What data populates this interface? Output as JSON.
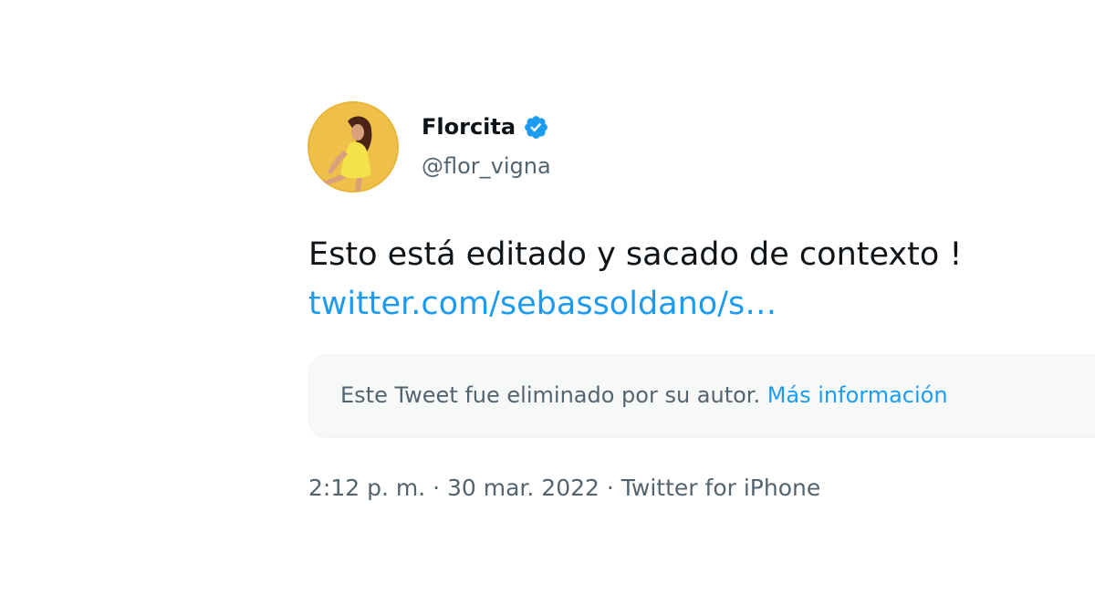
{
  "author": {
    "display_name": "Florcita",
    "handle": "@flor_vigna",
    "verified": true,
    "avatar_icon": "avatar-photo",
    "verified_icon": "verified-badge-icon"
  },
  "tweet": {
    "text": "Esto está editado y sacado de contexto !",
    "link": "twitter.com/sebassoldano/s…"
  },
  "deleted_notice": {
    "text": "Este Tweet fue eliminado por su autor.",
    "link_label": "Más información"
  },
  "meta": {
    "time": "2:12 p. m.",
    "separator": " · ",
    "date": "30 mar. 2022",
    "source": "Twitter for iPhone"
  },
  "colors": {
    "link": "#1d9bf0",
    "verified": "#1d9bf0",
    "secondary_text": "#536471",
    "primary_text": "#0f1419",
    "avatar_bg": "#e8b53a"
  }
}
